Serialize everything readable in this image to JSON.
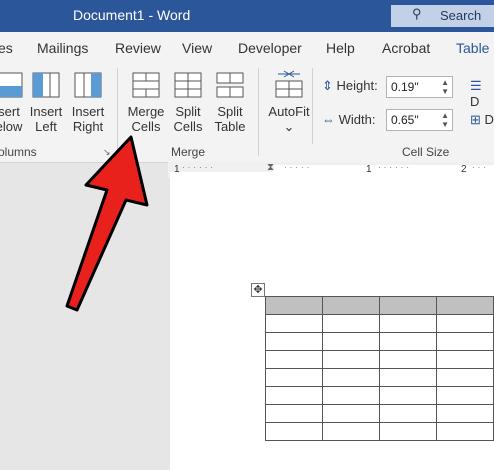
{
  "window": {
    "title": "Document1 - Word",
    "search_label": "Search"
  },
  "tabs": [
    "es",
    "Mailings",
    "Review",
    "View",
    "Developer",
    "Help",
    "Acrobat",
    "Table D"
  ],
  "ribbon": {
    "rows_columns": {
      "insert_below": [
        "sert",
        "elow"
      ],
      "insert_left": [
        "Insert",
        "Left"
      ],
      "insert_right": [
        "Insert",
        "Right"
      ],
      "group_label": "olumns"
    },
    "merge": {
      "merge_cells": [
        "Merge",
        "Cells"
      ],
      "split_cells": [
        "Split",
        "Cells"
      ],
      "split_table": [
        "Split",
        "Table"
      ],
      "group_label": "Merge"
    },
    "cell_size": {
      "autofit": "AutoFit",
      "height_label": "Height:",
      "height_value": "0.19\"",
      "width_label": "Width:",
      "width_value": "0.65\"",
      "group_label": "Cell Size",
      "distribute_rows": "D",
      "distribute_cols": "D"
    }
  },
  "ruler": {
    "marks": [
      "1",
      "1",
      "2"
    ]
  },
  "annotation_color": "#e8211d"
}
